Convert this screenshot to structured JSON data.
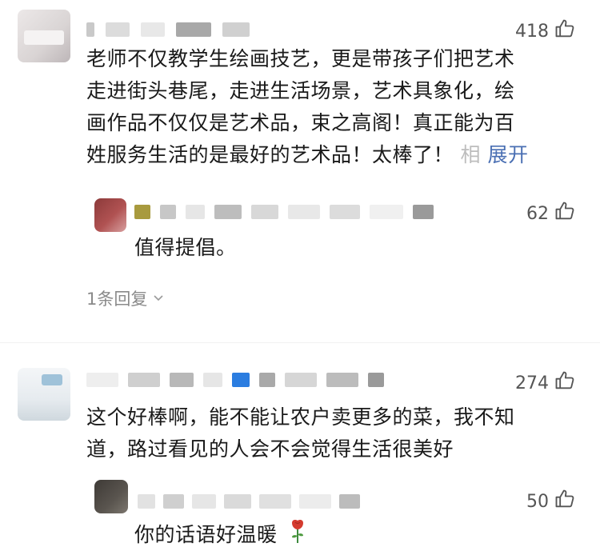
{
  "comments": [
    {
      "likes": "418",
      "text_lines": [
        "老师不仅教学生绘画技艺，更是带孩子们把艺术",
        "走进街头巷尾，走进生活场景，艺术具象化，绘",
        "画作品不仅仅是艺术品，束之高阁！真正能为百",
        "姓服务生活的是最好的艺术品！太棒了！"
      ],
      "truncated_tail": "相",
      "expand_label": "展开",
      "reply": {
        "likes": "62",
        "text": "值得提倡。"
      },
      "replies_toggle": "1条回复"
    },
    {
      "likes": "274",
      "text_lines": [
        "这个好棒啊，能不能让农户卖更多的菜，我不知",
        "道，路过看见的人会不会觉得生活很美好"
      ],
      "reply": {
        "likes": "50",
        "text": "你的话语好温暖"
      }
    }
  ],
  "icons": {
    "like": "thumbs-up-icon",
    "chevron": "chevron-down-icon",
    "rose": "rose-icon"
  },
  "colors": {
    "link": "#4a6fb3",
    "muted": "#8a8a8a",
    "text": "#1a1a1a"
  }
}
